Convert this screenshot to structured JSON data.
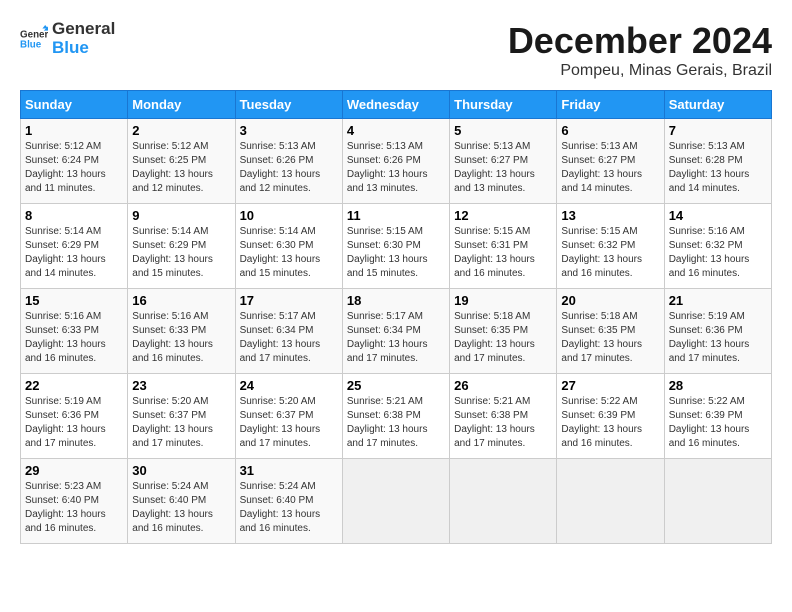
{
  "header": {
    "logo_line1": "General",
    "logo_line2": "Blue",
    "month": "December 2024",
    "location": "Pompeu, Minas Gerais, Brazil"
  },
  "weekdays": [
    "Sunday",
    "Monday",
    "Tuesday",
    "Wednesday",
    "Thursday",
    "Friday",
    "Saturday"
  ],
  "weeks": [
    [
      {
        "day": "1",
        "sunrise": "5:12 AM",
        "sunset": "6:24 PM",
        "daylight": "13 hours and 11 minutes."
      },
      {
        "day": "2",
        "sunrise": "5:12 AM",
        "sunset": "6:25 PM",
        "daylight": "13 hours and 12 minutes."
      },
      {
        "day": "3",
        "sunrise": "5:13 AM",
        "sunset": "6:26 PM",
        "daylight": "13 hours and 12 minutes."
      },
      {
        "day": "4",
        "sunrise": "5:13 AM",
        "sunset": "6:26 PM",
        "daylight": "13 hours and 13 minutes."
      },
      {
        "day": "5",
        "sunrise": "5:13 AM",
        "sunset": "6:27 PM",
        "daylight": "13 hours and 13 minutes."
      },
      {
        "day": "6",
        "sunrise": "5:13 AM",
        "sunset": "6:27 PM",
        "daylight": "13 hours and 14 minutes."
      },
      {
        "day": "7",
        "sunrise": "5:13 AM",
        "sunset": "6:28 PM",
        "daylight": "13 hours and 14 minutes."
      }
    ],
    [
      {
        "day": "8",
        "sunrise": "5:14 AM",
        "sunset": "6:29 PM",
        "daylight": "13 hours and 14 minutes."
      },
      {
        "day": "9",
        "sunrise": "5:14 AM",
        "sunset": "6:29 PM",
        "daylight": "13 hours and 15 minutes."
      },
      {
        "day": "10",
        "sunrise": "5:14 AM",
        "sunset": "6:30 PM",
        "daylight": "13 hours and 15 minutes."
      },
      {
        "day": "11",
        "sunrise": "5:15 AM",
        "sunset": "6:30 PM",
        "daylight": "13 hours and 15 minutes."
      },
      {
        "day": "12",
        "sunrise": "5:15 AM",
        "sunset": "6:31 PM",
        "daylight": "13 hours and 16 minutes."
      },
      {
        "day": "13",
        "sunrise": "5:15 AM",
        "sunset": "6:32 PM",
        "daylight": "13 hours and 16 minutes."
      },
      {
        "day": "14",
        "sunrise": "5:16 AM",
        "sunset": "6:32 PM",
        "daylight": "13 hours and 16 minutes."
      }
    ],
    [
      {
        "day": "15",
        "sunrise": "5:16 AM",
        "sunset": "6:33 PM",
        "daylight": "13 hours and 16 minutes."
      },
      {
        "day": "16",
        "sunrise": "5:16 AM",
        "sunset": "6:33 PM",
        "daylight": "13 hours and 16 minutes."
      },
      {
        "day": "17",
        "sunrise": "5:17 AM",
        "sunset": "6:34 PM",
        "daylight": "13 hours and 17 minutes."
      },
      {
        "day": "18",
        "sunrise": "5:17 AM",
        "sunset": "6:34 PM",
        "daylight": "13 hours and 17 minutes."
      },
      {
        "day": "19",
        "sunrise": "5:18 AM",
        "sunset": "6:35 PM",
        "daylight": "13 hours and 17 minutes."
      },
      {
        "day": "20",
        "sunrise": "5:18 AM",
        "sunset": "6:35 PM",
        "daylight": "13 hours and 17 minutes."
      },
      {
        "day": "21",
        "sunrise": "5:19 AM",
        "sunset": "6:36 PM",
        "daylight": "13 hours and 17 minutes."
      }
    ],
    [
      {
        "day": "22",
        "sunrise": "5:19 AM",
        "sunset": "6:36 PM",
        "daylight": "13 hours and 17 minutes."
      },
      {
        "day": "23",
        "sunrise": "5:20 AM",
        "sunset": "6:37 PM",
        "daylight": "13 hours and 17 minutes."
      },
      {
        "day": "24",
        "sunrise": "5:20 AM",
        "sunset": "6:37 PM",
        "daylight": "13 hours and 17 minutes."
      },
      {
        "day": "25",
        "sunrise": "5:21 AM",
        "sunset": "6:38 PM",
        "daylight": "13 hours and 17 minutes."
      },
      {
        "day": "26",
        "sunrise": "5:21 AM",
        "sunset": "6:38 PM",
        "daylight": "13 hours and 17 minutes."
      },
      {
        "day": "27",
        "sunrise": "5:22 AM",
        "sunset": "6:39 PM",
        "daylight": "13 hours and 16 minutes."
      },
      {
        "day": "28",
        "sunrise": "5:22 AM",
        "sunset": "6:39 PM",
        "daylight": "13 hours and 16 minutes."
      }
    ],
    [
      {
        "day": "29",
        "sunrise": "5:23 AM",
        "sunset": "6:40 PM",
        "daylight": "13 hours and 16 minutes."
      },
      {
        "day": "30",
        "sunrise": "5:24 AM",
        "sunset": "6:40 PM",
        "daylight": "13 hours and 16 minutes."
      },
      {
        "day": "31",
        "sunrise": "5:24 AM",
        "sunset": "6:40 PM",
        "daylight": "13 hours and 16 minutes."
      },
      null,
      null,
      null,
      null
    ]
  ]
}
